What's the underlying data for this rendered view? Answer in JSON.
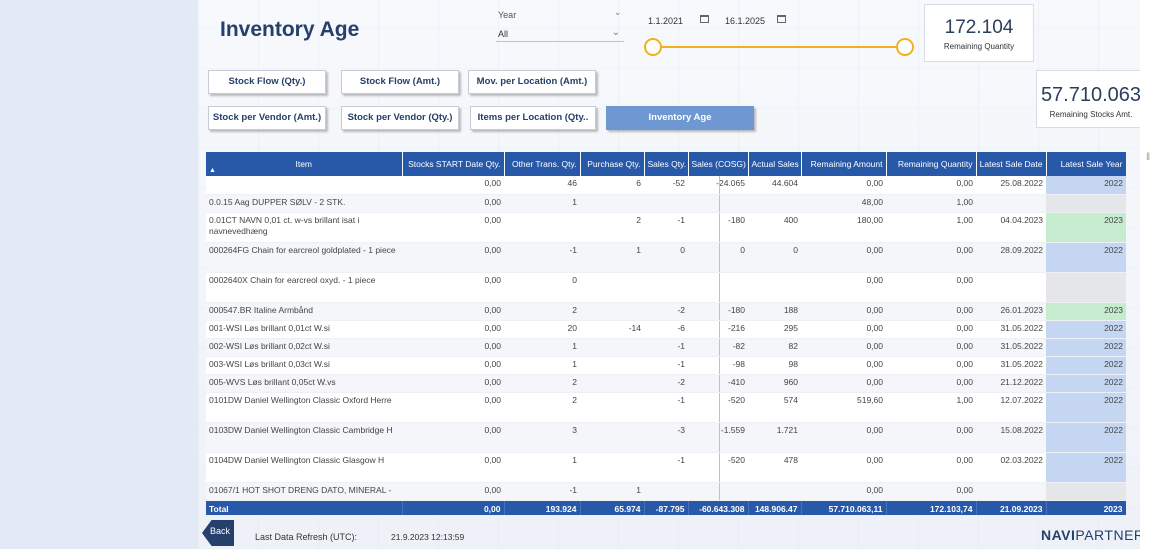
{
  "report": {
    "title": "Inventory Age",
    "year_slicer": {
      "label": "Year",
      "selected": "All"
    },
    "date_range": {
      "start": "1.1.2021",
      "end": "16.1.2025"
    },
    "kpis": {
      "remaining_quantity": {
        "value": "172.104",
        "label": "Remaining Quantity"
      },
      "remaining_stocks_amt": {
        "value": "57.710.063",
        "label": "Remaining Stocks Amt."
      }
    },
    "nav_buttons": [
      {
        "label": "Stock Flow (Qty.)",
        "active": false
      },
      {
        "label": "Stock Flow (Amt.)",
        "active": false
      },
      {
        "label": "Mov. per Location (Amt.)",
        "active": false
      },
      {
        "label": "Stock per Vendor (Amt.)",
        "active": false
      },
      {
        "label": "Stock per Vendor (Qty.)",
        "active": false
      },
      {
        "label": "Items per Location (Qty..",
        "active": false
      },
      {
        "label": "Inventory Age",
        "active": true
      }
    ],
    "table": {
      "columns": [
        "Item",
        "Stocks START Date Qty.",
        "Other Trans. Qty.",
        "Purchase Qty.",
        "Sales Qty.",
        "Sales (COSG)",
        "Actual Sales",
        "Remaining Amount",
        "Remaining Quantity",
        "Latest Sale Date",
        "Latest Sale Year"
      ],
      "rows": [
        [
          "",
          "0,00",
          "46",
          "6",
          "-52",
          "-24.065",
          "44.604",
          "0,00",
          "0,00",
          "25.08.2022",
          "2022"
        ],
        [
          "0.0.15 Aag DUPPER SØLV - 2 STK.",
          "0,00",
          "1",
          "",
          "",
          "",
          "",
          "48,00",
          "1,00",
          "",
          ""
        ],
        [
          "0.01CT NAVN 0,01 ct. w-vs brillant isat i navnevedhæng",
          "0,00",
          "",
          "2",
          "-1",
          "-180",
          "400",
          "180,00",
          "1,00",
          "04.04.2023",
          "2023"
        ],
        [
          "000264FG Chain for earcreol goldplated - 1 piece",
          "0,00",
          "-1",
          "1",
          "0",
          "0",
          "0",
          "0,00",
          "0,00",
          "28.09.2022",
          "2022"
        ],
        [
          "0002640X Chain for earcreol oxyd. - 1 piece",
          "0,00",
          "0",
          "",
          "",
          "",
          "",
          "0,00",
          "0,00",
          "",
          ""
        ],
        [
          "000547.BR Italine Armbånd",
          "0,00",
          "2",
          "",
          "-2",
          "-180",
          "188",
          "0,00",
          "0,00",
          "26.01.2023",
          "2023"
        ],
        [
          "001-WSI Løs brillant 0,01ct W.si",
          "0,00",
          "20",
          "-14",
          "-6",
          "-216",
          "295",
          "0,00",
          "0,00",
          "31.05.2022",
          "2022"
        ],
        [
          "002-WSI Løs brillant 0,02ct W.si",
          "0,00",
          "1",
          "",
          "-1",
          "-82",
          "82",
          "0,00",
          "0,00",
          "31.05.2022",
          "2022"
        ],
        [
          "003-WSI Løs brillant 0,03ct W.si",
          "0,00",
          "1",
          "",
          "-1",
          "-98",
          "98",
          "0,00",
          "0,00",
          "31.05.2022",
          "2022"
        ],
        [
          "005-WVS Løs brillant 0,05ct W.vs",
          "0,00",
          "2",
          "",
          "-2",
          "-410",
          "960",
          "0,00",
          "0,00",
          "21.12.2022",
          "2022"
        ],
        [
          "0101DW Daniel Wellington Classic Oxford Herre",
          "0,00",
          "2",
          "",
          "-1",
          "-520",
          "574",
          "519,60",
          "1,00",
          "12.07.2022",
          "2022"
        ],
        [
          "0103DW Daniel Wellington Classic Cambridge H",
          "0,00",
          "3",
          "",
          "-3",
          "-1.559",
          "1.721",
          "0,00",
          "0,00",
          "15.08.2022",
          "2022"
        ],
        [
          "0104DW Daniel Wellington Classic Glasgow H",
          "0,00",
          "1",
          "",
          "-1",
          "-520",
          "478",
          "0,00",
          "0,00",
          "02.03.2022",
          "2022"
        ],
        [
          "01067/1 HOT SHOT DRENG DATO, MINERAL -",
          "0,00",
          "-1",
          "1",
          "",
          "",
          "",
          "0,00",
          "0,00",
          "",
          ""
        ]
      ],
      "year_colors": [
        "blue",
        "grey",
        "green",
        "blue",
        "grey",
        "green",
        "blue",
        "blue",
        "blue",
        "blue",
        "blue",
        "blue",
        "blue",
        "grey"
      ],
      "total": [
        "Total",
        "0,00",
        "193.924",
        "65.974",
        "-87.795",
        "-60.643.308",
        "148.906.47\n3",
        "57.710.063,11",
        "172.103,74",
        "21.09.2023",
        "2023"
      ]
    },
    "footer": {
      "back_label": "Back",
      "refresh_label": "Last Data Refresh (UTC):",
      "refresh_value": "21.9.2023 12:13:59",
      "logo_bold": "NAVI",
      "logo_rest": "PARTNER"
    },
    "colors": {
      "header_blue": "#2859a8",
      "active_button": "#6f97d2",
      "slider_accent": "#f2b01e",
      "year_blue": "#c4d6f2",
      "year_green": "#c6ecd0"
    }
  }
}
